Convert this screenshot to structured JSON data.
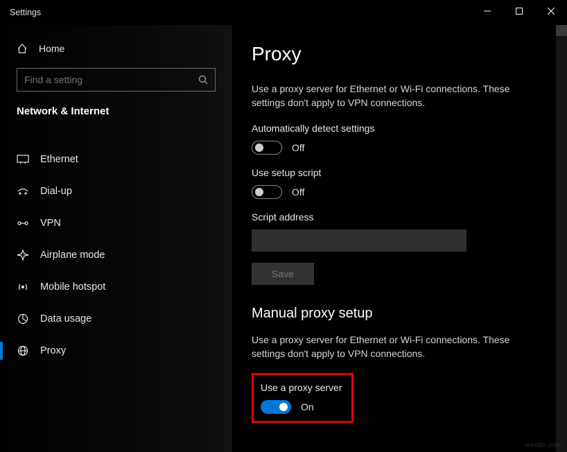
{
  "window": {
    "title": "Settings"
  },
  "sidebar": {
    "home": "Home",
    "search_placeholder": "Find a setting",
    "section": "Network & Internet",
    "items": [
      {
        "label": "Ethernet"
      },
      {
        "label": "Dial-up"
      },
      {
        "label": "VPN"
      },
      {
        "label": "Airplane mode"
      },
      {
        "label": "Mobile hotspot"
      },
      {
        "label": "Data usage"
      },
      {
        "label": "Proxy"
      }
    ]
  },
  "main": {
    "title": "Proxy",
    "auto_desc": "Use a proxy server for Ethernet or Wi-Fi connections. These settings don't apply to VPN connections.",
    "auto_detect_label": "Automatically detect settings",
    "auto_detect_state": "Off",
    "use_script_label": "Use setup script",
    "use_script_state": "Off",
    "script_address_label": "Script address",
    "script_address_value": "",
    "save_label": "Save",
    "manual_heading": "Manual proxy setup",
    "manual_desc": "Use a proxy server for Ethernet or Wi-Fi connections. These settings don't apply to VPN connections.",
    "use_proxy_label": "Use a proxy server",
    "use_proxy_state": "On"
  }
}
